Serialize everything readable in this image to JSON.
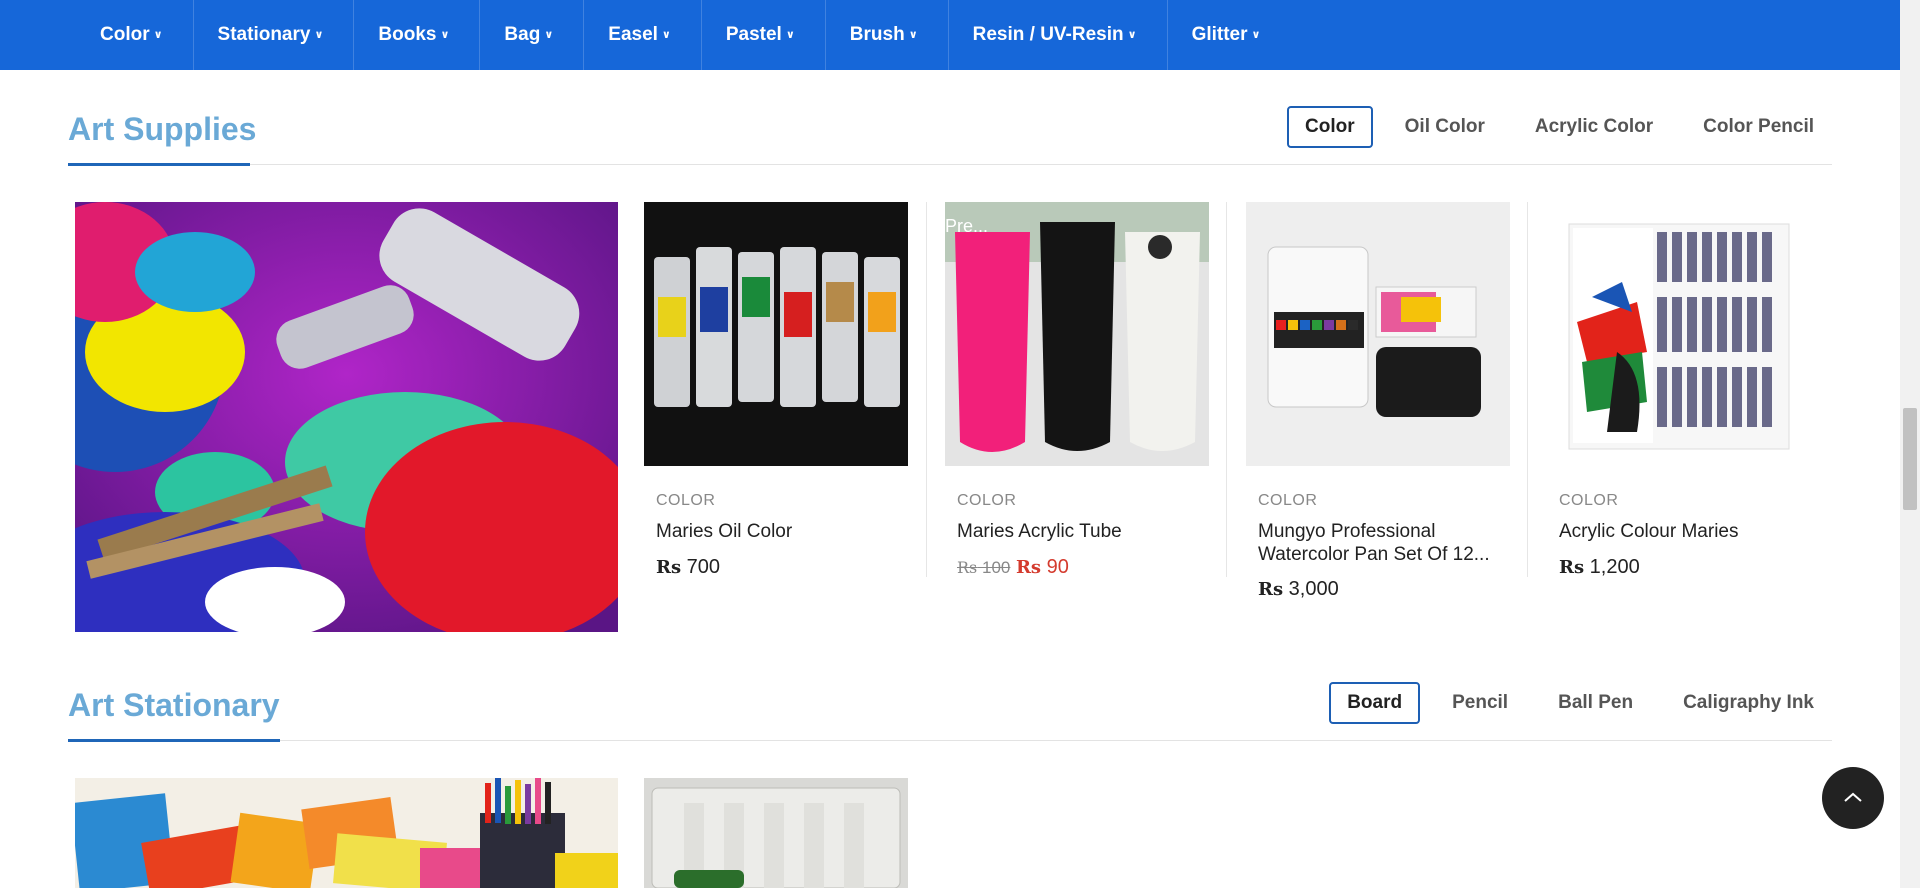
{
  "nav": {
    "items": [
      {
        "label": "Color"
      },
      {
        "label": "Stationary"
      },
      {
        "label": "Books"
      },
      {
        "label": "Bag"
      },
      {
        "label": "Easel"
      },
      {
        "label": "Pastel"
      },
      {
        "label": "Brush"
      },
      {
        "label": "Resin / UV-Resin"
      },
      {
        "label": "Glitter"
      }
    ],
    "chevron_icon": "chevron-down-icon"
  },
  "art_supplies": {
    "title": "Art Supplies",
    "filters": [
      "Color",
      "Oil Color",
      "Acrylic Color",
      "Color Pencil"
    ],
    "active_filter": "Color",
    "products": [
      {
        "category": "COLOR",
        "name": "Maries Oil Color",
        "currency": "Rs",
        "price": "700"
      },
      {
        "category": "COLOR",
        "name": "Maries Acrylic Tube",
        "currency": "Rs",
        "old_price": "100",
        "price": "90",
        "badge": "Pre..."
      },
      {
        "category": "COLOR",
        "name": "Mungyo Professional Watercolor Pan Set Of 12...",
        "currency": "Rs",
        "price": "3,000"
      },
      {
        "category": "COLOR",
        "name": "Acrylic Colour Maries",
        "currency": "Rs",
        "price": "1,200"
      }
    ]
  },
  "art_stationary": {
    "title": "Art Stationary",
    "filters": [
      "Board",
      "Pencil",
      "Ball Pen",
      "Caligraphy Ink"
    ],
    "active_filter": "Board"
  },
  "back_to_top_icon": "chevron-up-icon",
  "colors": {
    "nav_bg": "#1667d9",
    "section_title": "#6aa9d6",
    "sale_price": "#d43b2e"
  }
}
